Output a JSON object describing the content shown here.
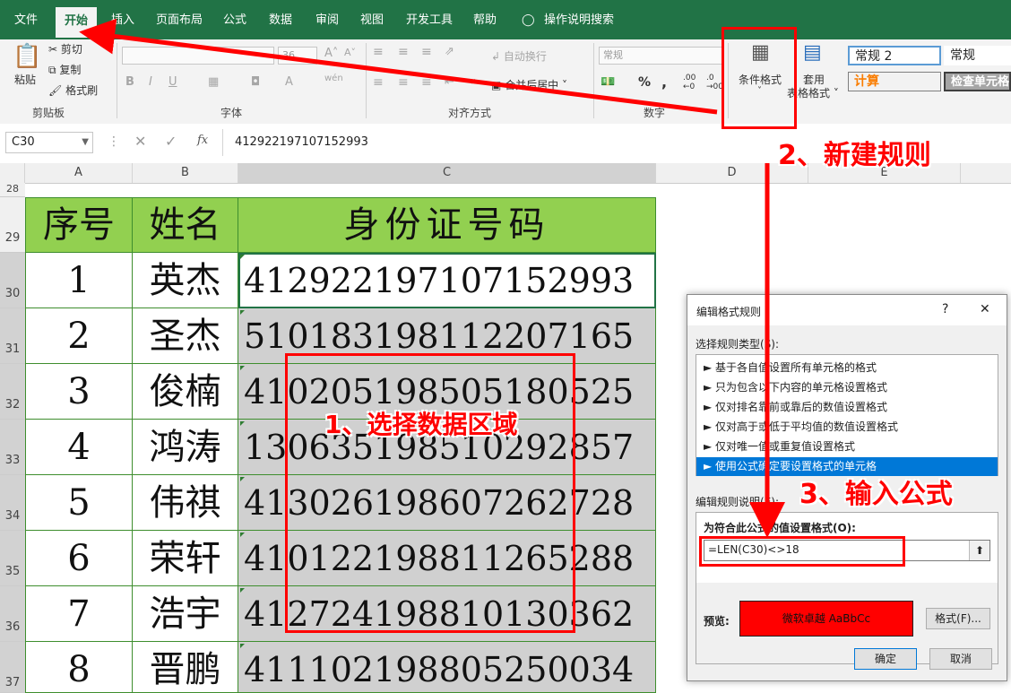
{
  "menu": {
    "tabs": [
      "文件",
      "开始",
      "插入",
      "页面布局",
      "公式",
      "数据",
      "审阅",
      "视图",
      "开发工具",
      "帮助"
    ],
    "search": "操作说明搜索"
  },
  "ribbon": {
    "clipboard": {
      "paste": "粘贴",
      "cut": "剪切",
      "copy": "复制",
      "format_painter": "格式刷",
      "label": "剪贴板"
    },
    "font": {
      "label": "字体",
      "size": "36"
    },
    "align": {
      "wrap": "自动换行",
      "merge": "合并后居中",
      "label": "对齐方式"
    },
    "number": {
      "format": "常规",
      "label": "数字"
    },
    "styles": {
      "cond_format": "条件格式",
      "table_format_1": "套用",
      "table_format_2": "表格格式",
      "style1": "常规 2",
      "style2": "常规",
      "style3": "计算",
      "style4": "检查单元格"
    }
  },
  "formula_bar": {
    "name_box": "C30",
    "fx": "fx",
    "value": "412922197107152993"
  },
  "sheet": {
    "columns": [
      "A",
      "B",
      "C",
      "D",
      "E"
    ],
    "rows": [
      "28",
      "29",
      "30",
      "31",
      "32",
      "33",
      "34",
      "35",
      "36",
      "37"
    ],
    "headers": [
      "序号",
      "姓名",
      "身份证号码"
    ],
    "data": [
      [
        "1",
        "英杰",
        "412922197107152993"
      ],
      [
        "2",
        "圣杰",
        "510183198112207165"
      ],
      [
        "3",
        "俊楠",
        "410205198505180525"
      ],
      [
        "4",
        "鸿涛",
        "130635198510292857"
      ],
      [
        "5",
        "伟祺",
        "413026198607262728"
      ],
      [
        "6",
        "荣轩",
        "410122198811265288"
      ],
      [
        "7",
        "浩宇",
        "412724198810130362"
      ],
      [
        "8",
        "晋鹏",
        "411102198805250034"
      ]
    ]
  },
  "dialog": {
    "title": "编辑格式规则",
    "help": "?",
    "close": "✕",
    "select_type_label": "选择规则类型(S):",
    "rules": [
      "基于各自值设置所有单元格的格式",
      "只为包含以下内容的单元格设置格式",
      "仅对排名靠前或靠后的数值设置格式",
      "仅对高于或低于平均值的数值设置格式",
      "仅对唯一值或重复值设置格式",
      "使用公式确定要设置格式的单元格"
    ],
    "edit_desc_label": "编辑规则说明(E):",
    "formula_label": "为符合此公式的值设置格式(O):",
    "formula": "=LEN(C30)<>18",
    "preview_label": "预览:",
    "preview_text": "微软卓越  AaBbCc",
    "format_button": "格式(F)...",
    "ok": "确定",
    "cancel": "取消"
  },
  "annotations": {
    "step1": "1、选择数据区域",
    "step2": "2、新建规则",
    "step3": "3、输入公式"
  }
}
